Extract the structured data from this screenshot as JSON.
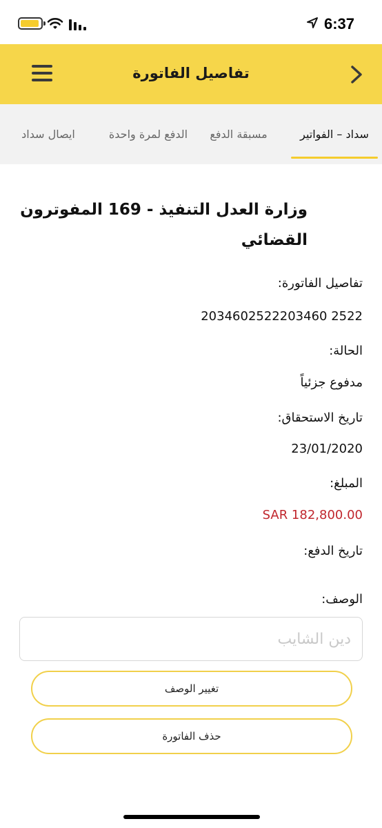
{
  "status_bar": {
    "time": "6:37"
  },
  "header": {
    "title": "تفاصيل الفاتورة"
  },
  "tabs": [
    {
      "label": "سداد – الفواتير",
      "active": true
    },
    {
      "label": "مسبقة الدفع",
      "active": false
    },
    {
      "label": "الدفع لمرة واحدة",
      "active": false
    },
    {
      "label": "ايصال سداد",
      "active": false
    }
  ],
  "bill": {
    "title": "وزارة العدل التنفيذ - 169 المفوترون القضائي",
    "details_label": "تفاصيل الفاتورة:",
    "details_value": "2034602522203460 2522",
    "status_label": "الحالة:",
    "status_value": "مدفوع جزئياً",
    "due_date_label": "تاريخ الاستحقاق:",
    "due_date_value": "23/01/2020",
    "amount_label": "المبلغ:",
    "amount_value": "SAR 182,800.00",
    "payment_date_label": "تاريخ الدفع:",
    "description_label": "الوصف:",
    "description_value": "دين الشايب"
  },
  "actions": {
    "change_description": "تغيير الوصف",
    "delete_bill": "حذف الفاتورة"
  },
  "colors": {
    "accent_yellow": "#f6d64a",
    "amount_red": "#c0262d"
  }
}
